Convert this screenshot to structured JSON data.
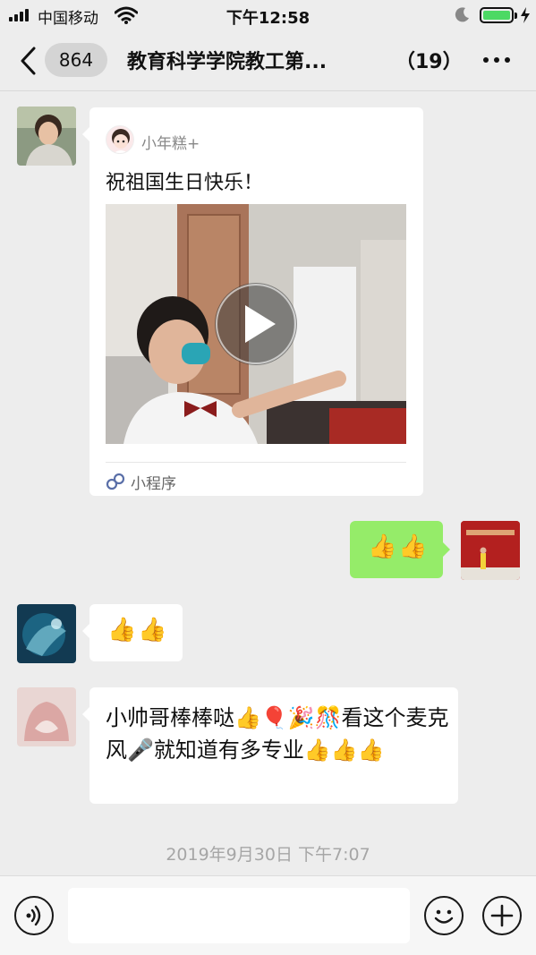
{
  "status_bar": {
    "carrier": "中国移动",
    "time": "下午12:58",
    "battery_color": "#4cd964"
  },
  "nav": {
    "unread_count": "864",
    "title": "教育科学学院教工第...",
    "member_count": "（19）",
    "back_icon": "chevron-left-icon",
    "more_icon": "more-dots-icon"
  },
  "messages": [
    {
      "type": "mini_program",
      "side": "left",
      "app_name": "小年糕+",
      "title": "祝祖国生日快乐！",
      "footer_label": "小程序",
      "footer_icon": "mini-program-link-icon",
      "media_icon": "play-icon"
    },
    {
      "type": "text",
      "side": "right",
      "text": "👍👍"
    },
    {
      "type": "text",
      "side": "left",
      "text": "👍👍"
    },
    {
      "type": "text",
      "side": "left",
      "text": "小帅哥棒棒哒👍🎈🎉🎊看这个麦克风🎤就知道有多专业👍👍👍"
    }
  ],
  "timestamp": "2019年9月30日 下午7:07",
  "input_bar": {
    "voice_icon": "voice-icon",
    "sticker_icon": "smiley-icon",
    "plus_icon": "plus-icon",
    "value": ""
  },
  "colors": {
    "background": "#ededed",
    "sent_bubble": "#95ec69",
    "received_bubble": "#ffffff"
  }
}
